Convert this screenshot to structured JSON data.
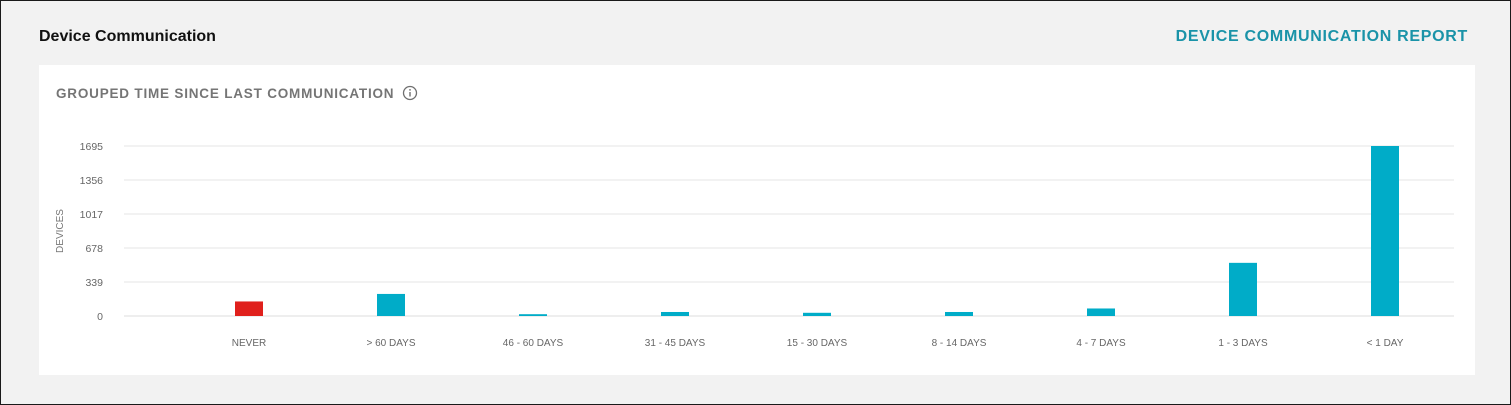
{
  "header": {
    "title": "Device Communication",
    "report_link": "DEVICE COMMUNICATION REPORT"
  },
  "card": {
    "title": "GROUPED TIME SINCE LAST COMMUNICATION",
    "info_icon": "info-icon"
  },
  "colors": {
    "accent": "#1a93a8",
    "bar": "#00acc8",
    "bar_alert": "#e0201c",
    "grid": "#e6e6e6"
  },
  "chart_data": {
    "type": "bar",
    "ylabel": "DEVICES",
    "xlabel": "",
    "yticks": [
      0,
      339,
      678,
      1017,
      1356,
      1695
    ],
    "ylim": [
      0,
      1695
    ],
    "grid": true,
    "categories": [
      "NEVER",
      "> 60 DAYS",
      "46 - 60 DAYS",
      "31 - 45 DAYS",
      "15 - 30 DAYS",
      "8 - 14 DAYS",
      "4 - 7 DAYS",
      "1 - 3 DAYS",
      "< 1 DAY"
    ],
    "values": [
      145,
      220,
      18,
      40,
      32,
      40,
      75,
      530,
      1695
    ],
    "bar_colors": [
      "#e0201c",
      "#00acc8",
      "#00acc8",
      "#00acc8",
      "#00acc8",
      "#00acc8",
      "#00acc8",
      "#00acc8",
      "#00acc8"
    ]
  }
}
